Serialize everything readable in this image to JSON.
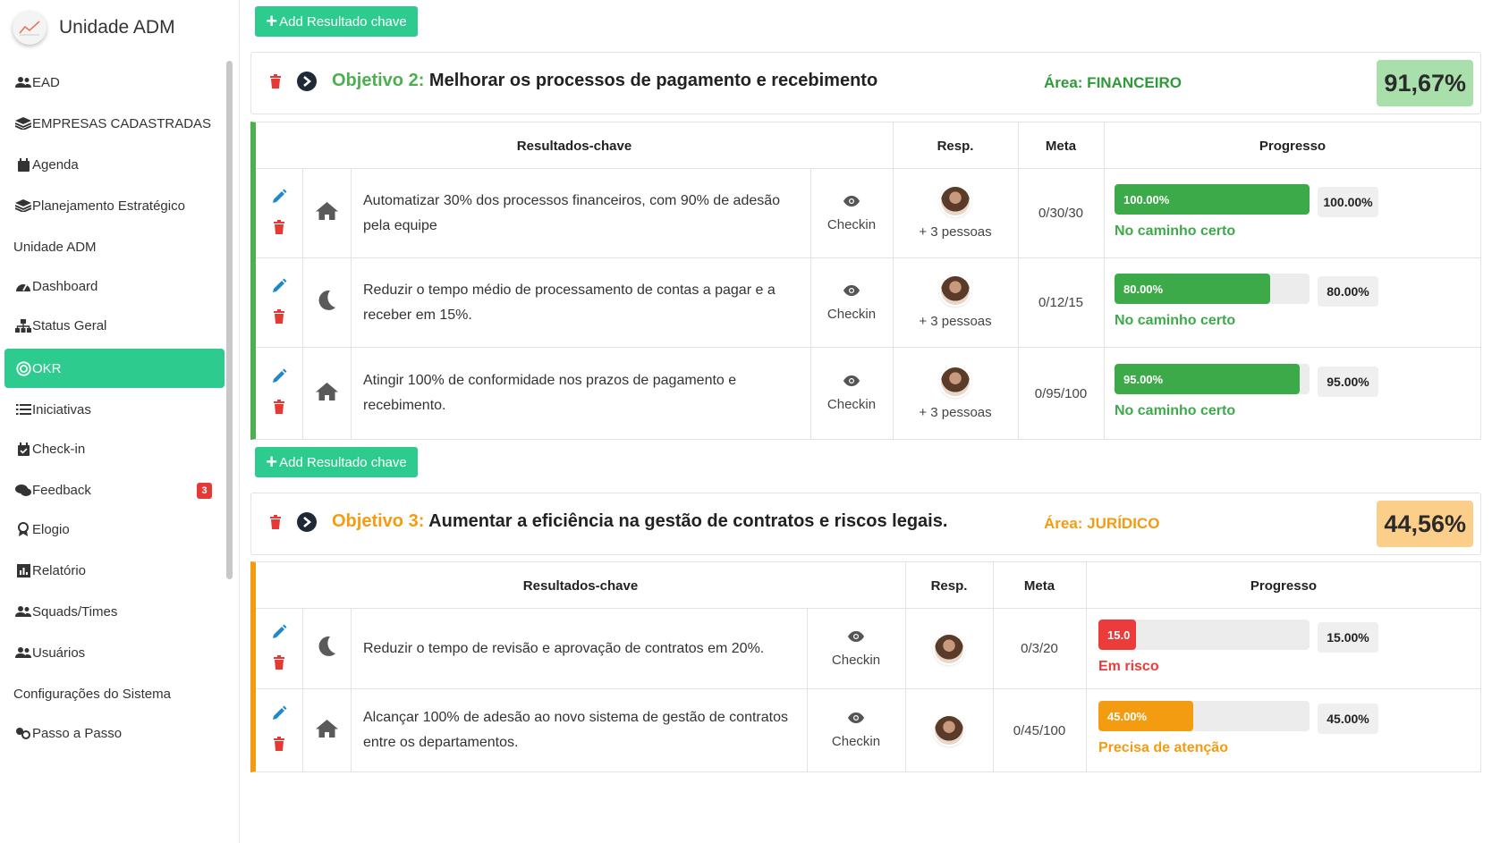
{
  "sidebar": {
    "brand": "Unidade ADM",
    "items": [
      {
        "label": "EAD",
        "icon": "users-icon"
      },
      {
        "label": "EMPRESAS CADASTRADAS",
        "icon": "layers-icon"
      },
      {
        "label": "Agenda",
        "icon": "calendar-icon"
      },
      {
        "label": "Planejamento Estratégico",
        "icon": "layers-icon"
      },
      {
        "label": "Unidade ADM",
        "icon": ""
      },
      {
        "label": "Dashboard",
        "icon": "gauge-icon"
      },
      {
        "label": "Status Geral",
        "icon": "sitemap-icon"
      },
      {
        "label": "OKR",
        "icon": "target-icon",
        "active": true
      },
      {
        "label": "Iniciativas",
        "icon": "list-icon"
      },
      {
        "label": "Check-in",
        "icon": "calendar-check-icon"
      },
      {
        "label": "Feedback",
        "icon": "comments-icon",
        "badge": "3"
      },
      {
        "label": "Elogio",
        "icon": "award-icon"
      },
      {
        "label": "Relatório",
        "icon": "chart-icon"
      },
      {
        "label": "Squads/Times",
        "icon": "users-icon"
      },
      {
        "label": "Usuários",
        "icon": "users-icon"
      },
      {
        "label": "Configurações do Sistema",
        "icon": ""
      },
      {
        "label": "Passo a Passo",
        "icon": "steps-icon"
      }
    ]
  },
  "add_button_label": "Add Resultado chave",
  "table_headers": {
    "kr": "Resultados-chave",
    "resp": "Resp.",
    "meta": "Meta",
    "progress": "Progresso"
  },
  "checkin_label": "Checkin",
  "objectives": [
    {
      "prefix": "Objetivo 2:",
      "title": "Melhorar os processos de pagamento e recebimento",
      "area": "Área: FINANCEIRO",
      "percent": "91,67%",
      "accent": "#4caf50",
      "pct_bg": "#a8dfaa",
      "results": [
        {
          "icon": "home-icon",
          "text": "Automatizar 30% dos processos financeiros, com 90% de adesão pela equipe",
          "resp": "+ 3 pessoas",
          "meta": "0/30/30",
          "progress": 1.0,
          "bar_label": "100.00%",
          "pct_label": "100.00%",
          "status": "No caminho certo",
          "color": "#3daa4a"
        },
        {
          "icon": "moon-icon",
          "text": "Reduzir o tempo médio de processamento de contas a pagar e a receber em 15%.",
          "resp": "+ 3 pessoas",
          "meta": "0/12/15",
          "progress": 0.8,
          "bar_label": "80.00%",
          "pct_label": "80.00%",
          "status": "No caminho certo",
          "color": "#3daa4a"
        },
        {
          "icon": "home-icon",
          "text": "Atingir 100% de conformidade nos prazos de pagamento e recebimento.",
          "resp": "+ 3 pessoas",
          "meta": "0/95/100",
          "progress": 0.95,
          "bar_label": "95.00%",
          "pct_label": "95.00%",
          "status": "No caminho certo",
          "color": "#3daa4a"
        }
      ]
    },
    {
      "prefix": "Objetivo 3:",
      "title": "Aumentar a eficiência na gestão de contratos e riscos legais.",
      "area": "Área: JURÍDICO",
      "percent": "44,56%",
      "accent": "#f39c12",
      "pct_bg": "#fbcf8a",
      "results": [
        {
          "icon": "moon-icon",
          "text": "Reduzir o tempo de revisão e aprovação de contratos em 20%.",
          "resp": "",
          "meta": "0/3/20",
          "progress": 0.15,
          "bar_label": "15.0",
          "pct_label": "15.00%",
          "status": "Em risco",
          "color": "#ec3b3b"
        },
        {
          "icon": "home-icon",
          "text": "Alcançar 100% de adesão ao novo sistema de gestão de contratos entre os departamentos.",
          "resp": "",
          "meta": "0/45/100",
          "progress": 0.45,
          "bar_label": "45.00%",
          "pct_label": "45.00%",
          "status": "Precisa de atenção",
          "color": "#f39c12"
        }
      ]
    }
  ]
}
